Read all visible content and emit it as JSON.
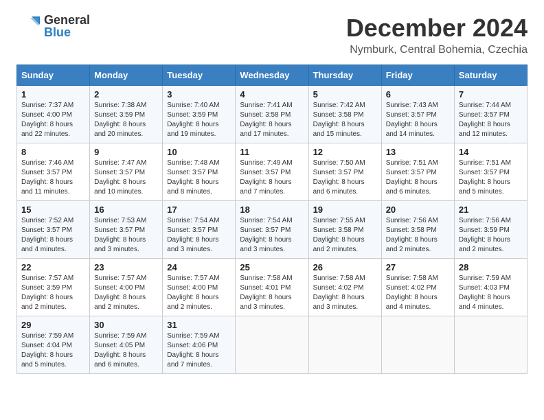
{
  "header": {
    "logo_general": "General",
    "logo_blue": "Blue",
    "title": "December 2024",
    "subtitle": "Nymburk, Central Bohemia, Czechia"
  },
  "calendar": {
    "weekdays": [
      "Sunday",
      "Monday",
      "Tuesday",
      "Wednesday",
      "Thursday",
      "Friday",
      "Saturday"
    ],
    "weeks": [
      [
        {
          "day": "1",
          "sunrise": "7:37 AM",
          "sunset": "4:00 PM",
          "daylight": "8 hours and 22 minutes."
        },
        {
          "day": "2",
          "sunrise": "7:38 AM",
          "sunset": "3:59 PM",
          "daylight": "8 hours and 20 minutes."
        },
        {
          "day": "3",
          "sunrise": "7:40 AM",
          "sunset": "3:59 PM",
          "daylight": "8 hours and 19 minutes."
        },
        {
          "day": "4",
          "sunrise": "7:41 AM",
          "sunset": "3:58 PM",
          "daylight": "8 hours and 17 minutes."
        },
        {
          "day": "5",
          "sunrise": "7:42 AM",
          "sunset": "3:58 PM",
          "daylight": "8 hours and 15 minutes."
        },
        {
          "day": "6",
          "sunrise": "7:43 AM",
          "sunset": "3:57 PM",
          "daylight": "8 hours and 14 minutes."
        },
        {
          "day": "7",
          "sunrise": "7:44 AM",
          "sunset": "3:57 PM",
          "daylight": "8 hours and 12 minutes."
        }
      ],
      [
        {
          "day": "8",
          "sunrise": "7:46 AM",
          "sunset": "3:57 PM",
          "daylight": "8 hours and 11 minutes."
        },
        {
          "day": "9",
          "sunrise": "7:47 AM",
          "sunset": "3:57 PM",
          "daylight": "8 hours and 10 minutes."
        },
        {
          "day": "10",
          "sunrise": "7:48 AM",
          "sunset": "3:57 PM",
          "daylight": "8 hours and 8 minutes."
        },
        {
          "day": "11",
          "sunrise": "7:49 AM",
          "sunset": "3:57 PM",
          "daylight": "8 hours and 7 minutes."
        },
        {
          "day": "12",
          "sunrise": "7:50 AM",
          "sunset": "3:57 PM",
          "daylight": "8 hours and 6 minutes."
        },
        {
          "day": "13",
          "sunrise": "7:51 AM",
          "sunset": "3:57 PM",
          "daylight": "8 hours and 6 minutes."
        },
        {
          "day": "14",
          "sunrise": "7:51 AM",
          "sunset": "3:57 PM",
          "daylight": "8 hours and 5 minutes."
        }
      ],
      [
        {
          "day": "15",
          "sunrise": "7:52 AM",
          "sunset": "3:57 PM",
          "daylight": "8 hours and 4 minutes."
        },
        {
          "day": "16",
          "sunrise": "7:53 AM",
          "sunset": "3:57 PM",
          "daylight": "8 hours and 3 minutes."
        },
        {
          "day": "17",
          "sunrise": "7:54 AM",
          "sunset": "3:57 PM",
          "daylight": "8 hours and 3 minutes."
        },
        {
          "day": "18",
          "sunrise": "7:54 AM",
          "sunset": "3:57 PM",
          "daylight": "8 hours and 3 minutes."
        },
        {
          "day": "19",
          "sunrise": "7:55 AM",
          "sunset": "3:58 PM",
          "daylight": "8 hours and 2 minutes."
        },
        {
          "day": "20",
          "sunrise": "7:56 AM",
          "sunset": "3:58 PM",
          "daylight": "8 hours and 2 minutes."
        },
        {
          "day": "21",
          "sunrise": "7:56 AM",
          "sunset": "3:59 PM",
          "daylight": "8 hours and 2 minutes."
        }
      ],
      [
        {
          "day": "22",
          "sunrise": "7:57 AM",
          "sunset": "3:59 PM",
          "daylight": "8 hours and 2 minutes."
        },
        {
          "day": "23",
          "sunrise": "7:57 AM",
          "sunset": "4:00 PM",
          "daylight": "8 hours and 2 minutes."
        },
        {
          "day": "24",
          "sunrise": "7:57 AM",
          "sunset": "4:00 PM",
          "daylight": "8 hours and 2 minutes."
        },
        {
          "day": "25",
          "sunrise": "7:58 AM",
          "sunset": "4:01 PM",
          "daylight": "8 hours and 3 minutes."
        },
        {
          "day": "26",
          "sunrise": "7:58 AM",
          "sunset": "4:02 PM",
          "daylight": "8 hours and 3 minutes."
        },
        {
          "day": "27",
          "sunrise": "7:58 AM",
          "sunset": "4:02 PM",
          "daylight": "8 hours and 4 minutes."
        },
        {
          "day": "28",
          "sunrise": "7:59 AM",
          "sunset": "4:03 PM",
          "daylight": "8 hours and 4 minutes."
        }
      ],
      [
        {
          "day": "29",
          "sunrise": "7:59 AM",
          "sunset": "4:04 PM",
          "daylight": "8 hours and 5 minutes."
        },
        {
          "day": "30",
          "sunrise": "7:59 AM",
          "sunset": "4:05 PM",
          "daylight": "8 hours and 6 minutes."
        },
        {
          "day": "31",
          "sunrise": "7:59 AM",
          "sunset": "4:06 PM",
          "daylight": "8 hours and 7 minutes."
        },
        null,
        null,
        null,
        null
      ]
    ]
  },
  "labels": {
    "sunrise": "Sunrise:",
    "sunset": "Sunset:",
    "daylight": "Daylight:"
  }
}
